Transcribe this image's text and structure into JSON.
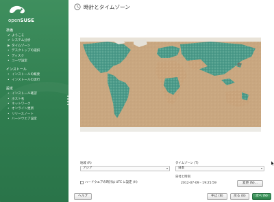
{
  "brand": {
    "name_light": "open",
    "name_bold": "SUSE"
  },
  "sidebar": {
    "sections": [
      {
        "label": "準備",
        "items": [
          {
            "label": "ようこそ",
            "mark": "✔"
          },
          {
            "label": "システム分析",
            "mark": "✔"
          },
          {
            "label": "タイムゾーン",
            "mark": "▶"
          },
          {
            "label": "デスクトップの選択",
            "mark": "•"
          },
          {
            "label": "ディスク",
            "mark": "•"
          },
          {
            "label": "ユーザ設定",
            "mark": "•"
          }
        ]
      },
      {
        "label": "インストール",
        "items": [
          {
            "label": "インストールの概要",
            "mark": "•"
          },
          {
            "label": "インストールの実行",
            "mark": "•"
          }
        ]
      },
      {
        "label": "設定",
        "items": [
          {
            "label": "インストール確認",
            "mark": "•"
          },
          {
            "label": "ホスト名",
            "mark": "•"
          },
          {
            "label": "ネットワーク",
            "mark": "•"
          },
          {
            "label": "オンライン更新",
            "mark": "•"
          },
          {
            "label": "リリースノート",
            "mark": "•"
          },
          {
            "label": "ハードウエア設定",
            "mark": "•"
          }
        ]
      }
    ]
  },
  "main": {
    "title": "時計とタイムゾーン",
    "region_label": "地域 (R)",
    "region_value": "アジア",
    "timezone_label": "タイムゾーン (T)",
    "timezone_value": "日本",
    "hwclock_label": "ハードウエアの時計は UTC に設定 (H)",
    "datetime_label": "日付と時刻",
    "datetime_value": "2012-07-09 - 19:25:59",
    "change_button": "変更 (N)...",
    "help_button": "ヘルプ",
    "abort_button": "中止 (B)",
    "back_button": "戻る (B)",
    "next_button": "次へ (N)"
  },
  "colors": {
    "sidebar": "#2f7d4f",
    "land": "#c9a47c",
    "forest": "#4a9a8c",
    "primary_button": "#2d7f4a"
  }
}
